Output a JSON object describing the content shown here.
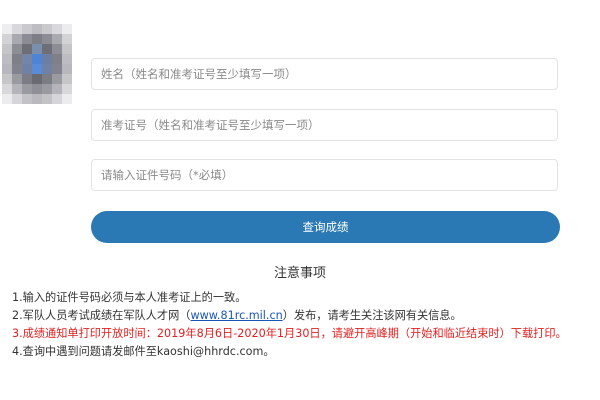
{
  "form": {
    "name_placeholder": "姓名（姓名和准考证号至少填写一项）",
    "exam_no_placeholder": "准考证号（姓名和准考证号至少填写一项）",
    "id_placeholder": "请输入证件号码（*必填）",
    "submit_label": "查询成绩"
  },
  "notes": {
    "title": "注意事项",
    "items": [
      {
        "text": "1.输入的证件号码必须与本人准考证上的一致。"
      },
      {
        "prefix": "2.军队人员考试成绩在军队人才网（",
        "link": "www.81rc.mil.cn",
        "suffix": "）发布，请考生关注该网有关信息。"
      },
      {
        "text": "3.成绩通知单打印开放时间：2019年8月6日-2020年1月30日，请避开高峰期（开始和临近结束时）下载打印。"
      },
      {
        "text": "4.查询中遇到问题请发邮件至kaoshi@hhrdc.com。"
      }
    ]
  },
  "colors": {
    "button": "#2a79b4",
    "warning_text": "#e02020",
    "link": "#1a56b8"
  }
}
